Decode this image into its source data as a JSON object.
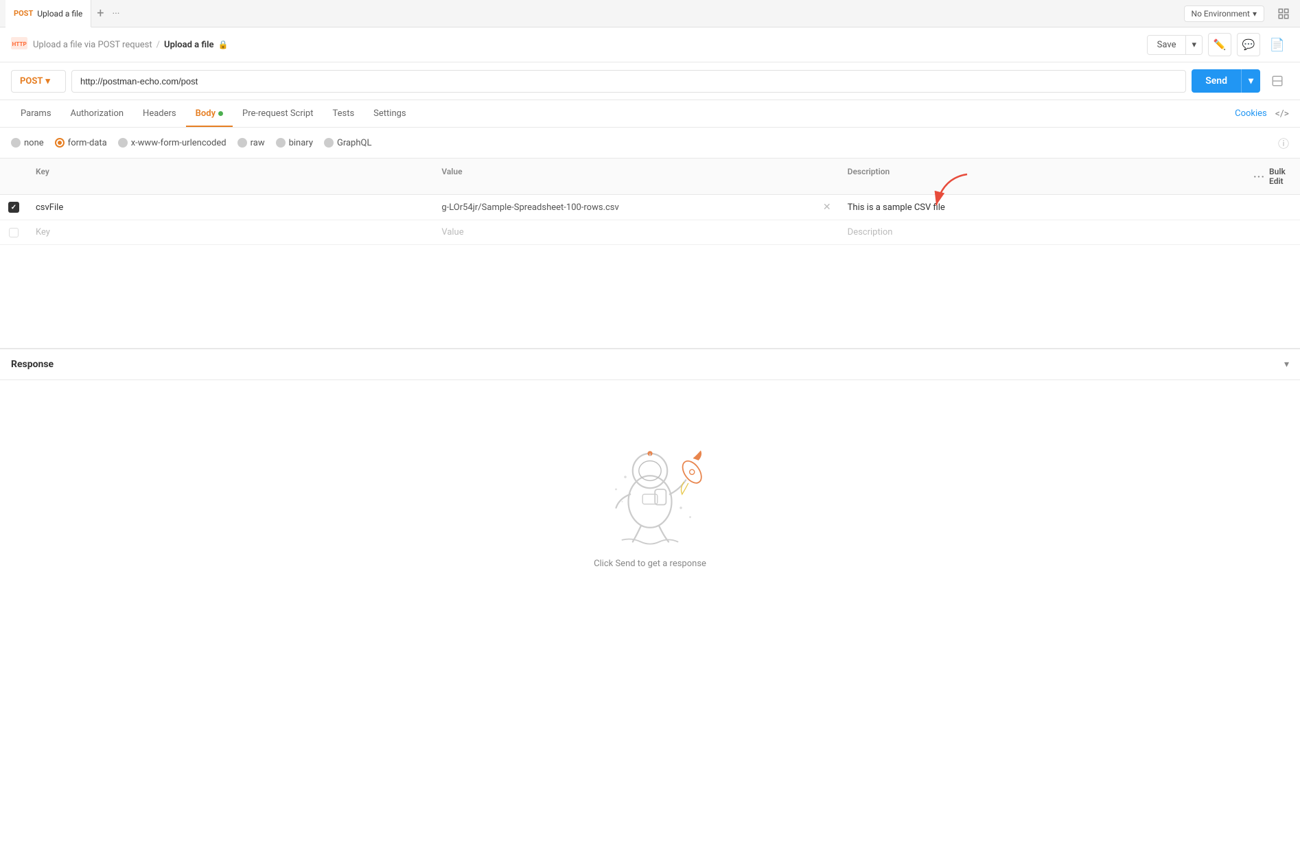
{
  "tab": {
    "method": "POST",
    "title": "Upload a file",
    "add_icon": "+",
    "more_icon": "···"
  },
  "env": {
    "label": "No Environment",
    "chevron": "▾"
  },
  "breadcrumb": {
    "prefix": "Upload a file via POST request",
    "separator": "/",
    "current": "Upload a file",
    "lock": "🔒"
  },
  "toolbar": {
    "save_label": "Save",
    "save_arrow": "▾"
  },
  "url_bar": {
    "method": "POST",
    "method_chevron": "▾",
    "url": "http://postman-echo.com/post",
    "send_label": "Send",
    "send_arrow": "▾"
  },
  "tabs": {
    "items": [
      {
        "id": "params",
        "label": "Params",
        "active": false,
        "dot": false
      },
      {
        "id": "authorization",
        "label": "Authorization",
        "active": false,
        "dot": false
      },
      {
        "id": "headers",
        "label": "Headers",
        "active": false,
        "dot": false
      },
      {
        "id": "body",
        "label": "Body",
        "active": true,
        "dot": true
      },
      {
        "id": "prerequest",
        "label": "Pre-request Script",
        "active": false,
        "dot": false
      },
      {
        "id": "tests",
        "label": "Tests",
        "active": false,
        "dot": false
      },
      {
        "id": "settings",
        "label": "Settings",
        "active": false,
        "dot": false
      }
    ],
    "cookies": "Cookies",
    "code": "</>"
  },
  "body_types": [
    {
      "id": "none",
      "label": "none",
      "active": false
    },
    {
      "id": "form-data",
      "label": "form-data",
      "active": true
    },
    {
      "id": "urlencoded",
      "label": "x-www-form-urlencoded",
      "active": false
    },
    {
      "id": "raw",
      "label": "raw",
      "active": false
    },
    {
      "id": "binary",
      "label": "binary",
      "active": false
    },
    {
      "id": "graphql",
      "label": "GraphQL",
      "active": false
    }
  ],
  "form_table": {
    "columns": [
      "",
      "Key",
      "Value",
      "Description",
      ""
    ],
    "bulk_edit": "Bulk Edit",
    "rows": [
      {
        "checked": true,
        "key": "csvFile",
        "value": "g-LOr54jr/Sample-Spreadsheet-100-rows.csv",
        "description": "This is a sample CSV file",
        "has_remove": true
      }
    ],
    "placeholder_row": {
      "key": "Key",
      "value": "Value",
      "description": "Description"
    }
  },
  "response": {
    "title": "Response",
    "chevron": "▾",
    "hint": "Click Send to get a response"
  }
}
